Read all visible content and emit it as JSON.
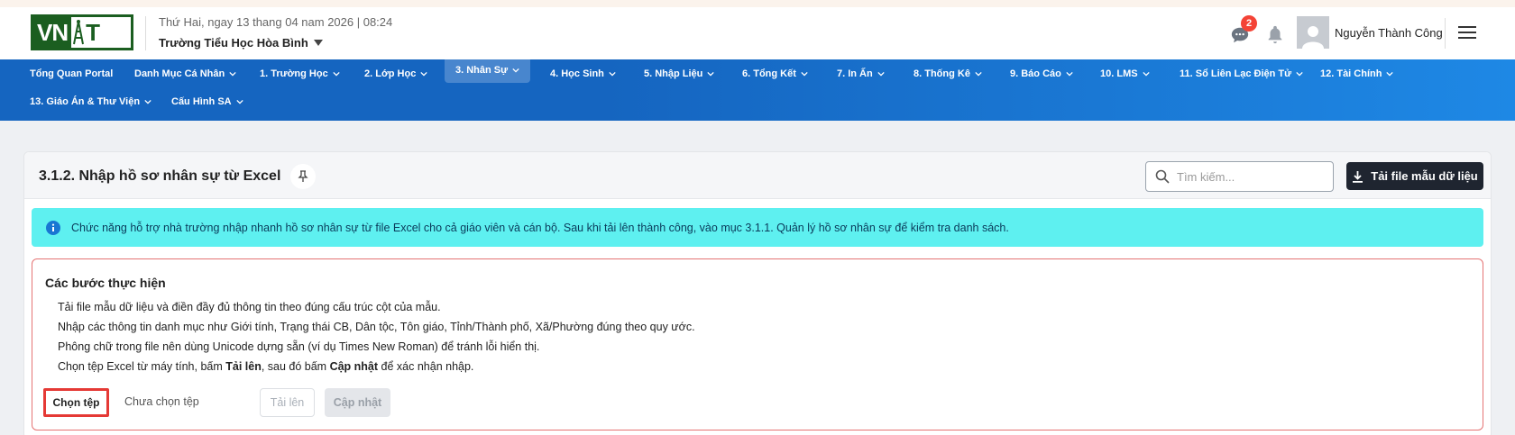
{
  "header": {
    "logo_left": "VN",
    "logo_right": "T",
    "date_line": "Thứ Hai, ngay 13 thang 04 nam 2026 | 08:24",
    "school": "Trường Tiểu Học Hòa Bình",
    "notification_count": "2",
    "user_name": "Nguyễn Thành Công",
    "icons": [
      "chat-icon",
      "bell-icon",
      "avatar-icon",
      "menu-icon"
    ]
  },
  "nav": {
    "row1": [
      {
        "label": "Tổng Quan Portal",
        "dropdown": false
      },
      {
        "label": "Danh Mục Cá Nhân",
        "dropdown": true
      },
      {
        "label": "1. Trường Học",
        "dropdown": true
      },
      {
        "label": "2. Lớp Học",
        "dropdown": true
      },
      {
        "label": "3. Nhân Sự",
        "dropdown": true,
        "active": true
      },
      {
        "label": "4. Học Sinh",
        "dropdown": true
      },
      {
        "label": "5. Nhập Liệu",
        "dropdown": true
      },
      {
        "label": "6. Tổng Kết",
        "dropdown": true
      },
      {
        "label": "7. In Ấn",
        "dropdown": true
      },
      {
        "label": "8. Thống Kê",
        "dropdown": true
      },
      {
        "label": "9. Báo Cáo",
        "dropdown": true
      },
      {
        "label": "10. LMS",
        "dropdown": true
      },
      {
        "label": "11. Sổ Liên Lạc Điện Tử",
        "dropdown": true
      },
      {
        "label": "12. Tài Chính",
        "dropdown": true
      }
    ],
    "row2": [
      {
        "label": "13. Giáo Án & Thư Viện",
        "dropdown": true
      },
      {
        "label": "Cấu Hình SA",
        "dropdown": true
      }
    ]
  },
  "panel": {
    "title": "3.1.2. Nhập hồ sơ nhân sự từ Excel",
    "search_placeholder": "Tìm kiếm...",
    "download_label": "Tải file mẫu dữ liệu",
    "info_text": "Chức năng hỗ trợ nhà trường nhập nhanh hồ sơ nhân sự từ file Excel cho cả giáo viên và cán bộ. Sau khi tải lên thành công, vào mục 3.1.1. Quản lý hồ sơ nhân sự để kiểm tra danh sách.",
    "steps_title": "Các bước thực hiện",
    "steps": [
      "Tải file mẫu dữ liệu và điền đầy đủ thông tin theo đúng cấu trúc cột của mẫu.",
      "Nhập các thông tin danh mục như Giới tính, Trạng thái CB, Dân tộc, Tôn giáo, Tỉnh/Thành phố, Xã/Phường đúng theo quy ước.",
      "Phông chữ trong file nên dùng Unicode dựng sẵn (ví dụ Times New Roman) để tránh lỗi hiển thị."
    ],
    "step4": {
      "a": "Chọn tệp Excel từ máy tính, bấm ",
      "b": "Tải lên",
      "c": ", sau đó bấm ",
      "d": "Cập nhật",
      "e": " để xác nhận nhập."
    },
    "choose_label": "Chọn tệp",
    "no_file_label": "Chưa chọn tệp",
    "upload_label": "Tải lên",
    "update_label": "Cập nhật"
  },
  "colors": {
    "nav_bg": "#1565c0",
    "info_bg": "#5ef0f0",
    "steps_border": "#e57373",
    "highlight": "#e53935"
  }
}
